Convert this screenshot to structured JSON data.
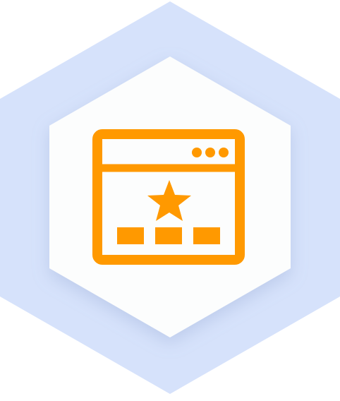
{
  "badge": {
    "icon": "web-page-featured-icon",
    "colors": {
      "outer_hexagon": "#d6e2fb",
      "inner_hexagon": "#fcfdfd",
      "icon_accent": "#ff9900"
    }
  }
}
